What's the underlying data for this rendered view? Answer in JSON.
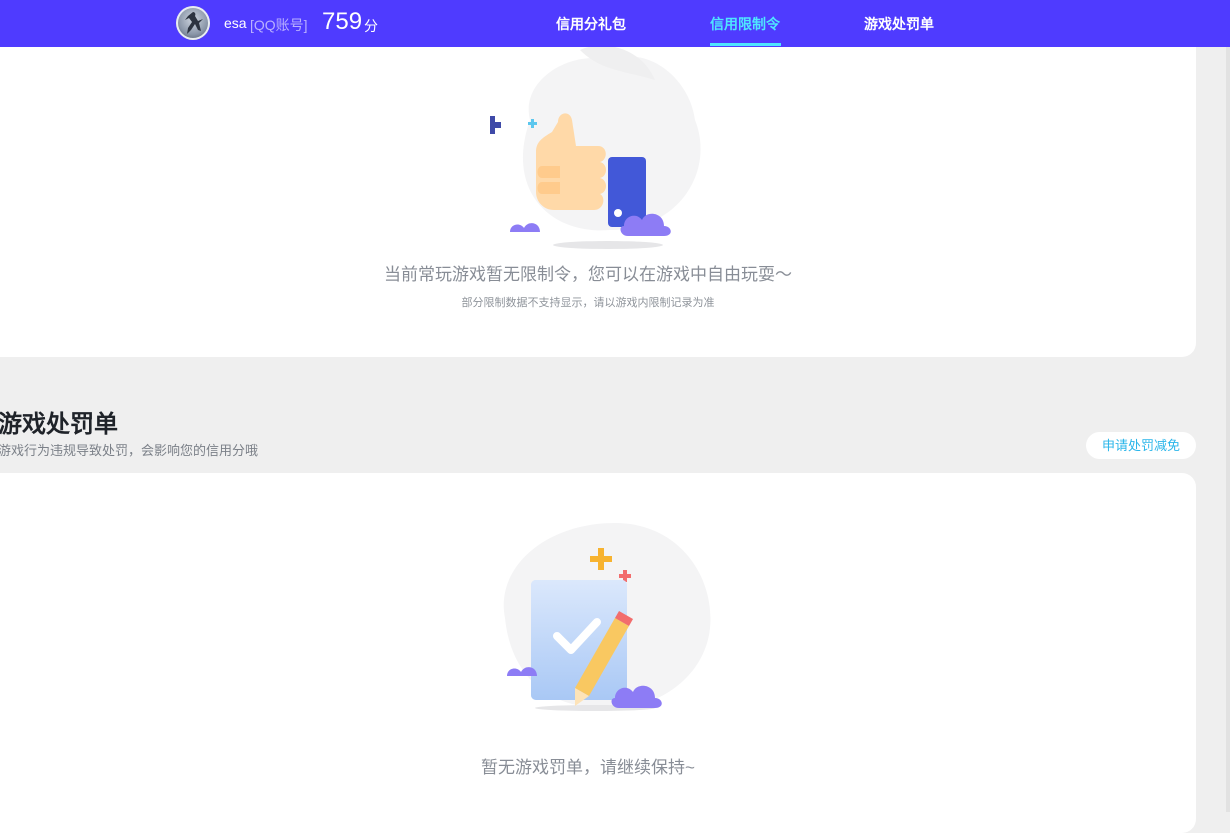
{
  "header": {
    "username": "esa",
    "account_type": "[QQ账号]",
    "score": "759",
    "score_unit": "分",
    "nav": [
      {
        "label": "信用分礼包",
        "active": false
      },
      {
        "label": "信用限制令",
        "active": true
      },
      {
        "label": "游戏处罚单",
        "active": false
      }
    ]
  },
  "restriction": {
    "empty_title": "当前常玩游戏暂无限制令，您可以在游戏中自由玩耍～",
    "empty_note": "部分限制数据不支持显示，请以游戏内限制记录为准"
  },
  "penalty": {
    "title": "游戏处罚单",
    "description": "游戏行为违规导致处罚，会影响您的信用分哦",
    "appeal_label": "申请处罚减免",
    "empty_title": "暂无游戏罚单，请继续保持~"
  },
  "colors": {
    "brand": "#4f3bff",
    "active_nav": "#4fe6ff",
    "link": "#2bb6ea"
  }
}
